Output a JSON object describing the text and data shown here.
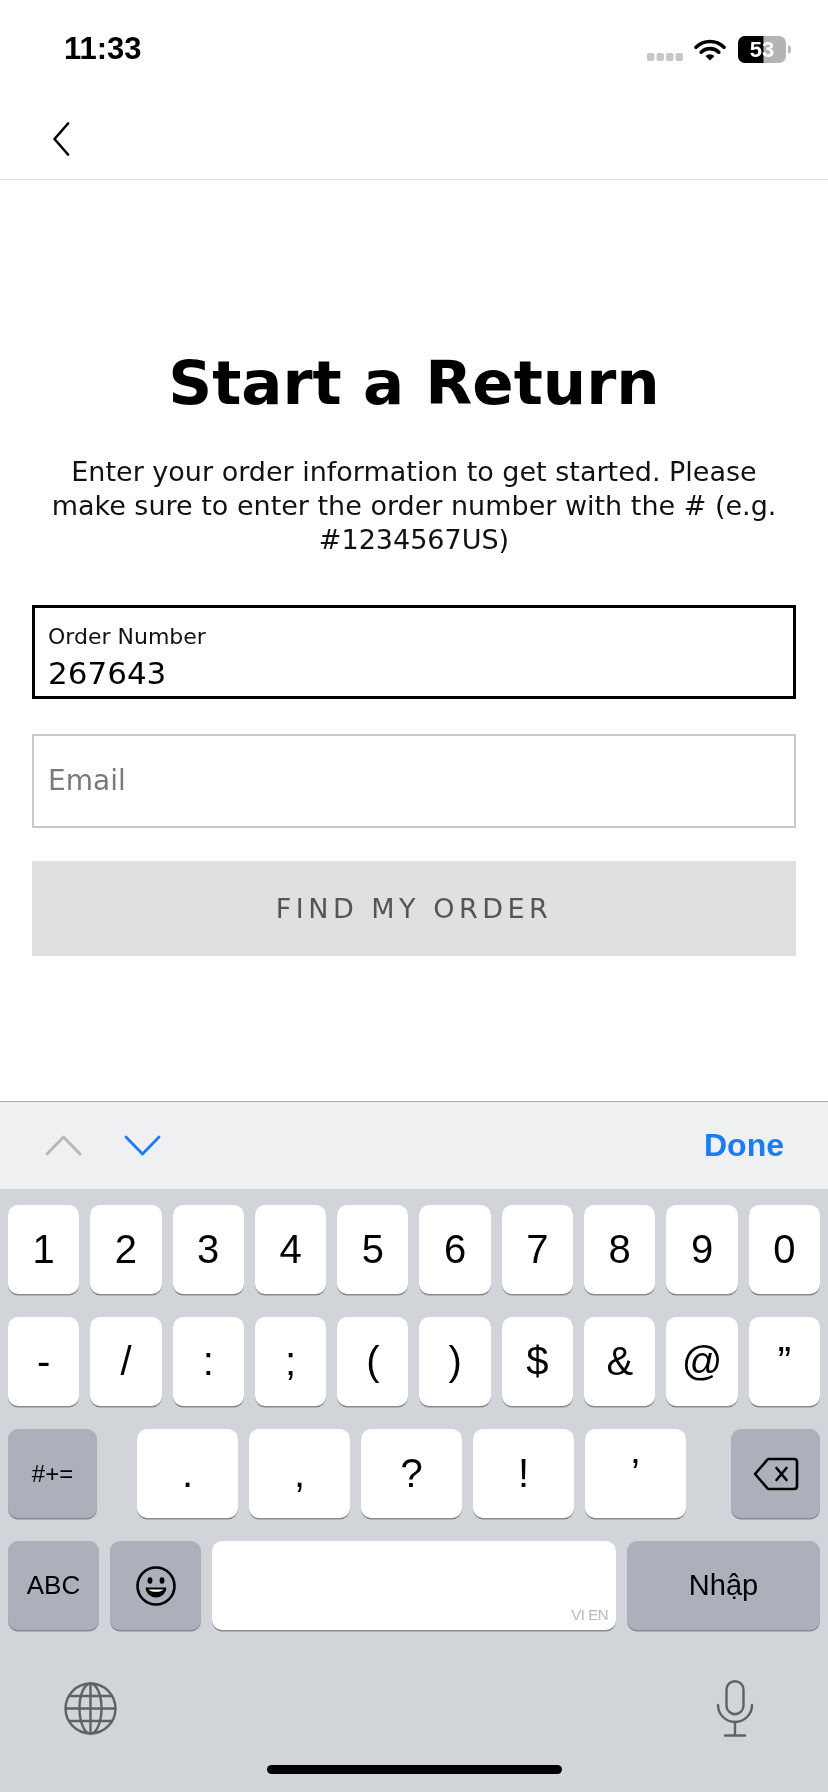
{
  "status_bar": {
    "time": "11:33",
    "battery": "53"
  },
  "page": {
    "title": "Start a Return",
    "description": "Enter your order information to get started. Please make sure to enter the order number with the # (e.g. #1234567US)"
  },
  "form": {
    "fields": [
      {
        "label": "Order Number",
        "value": "267643",
        "focused": true
      },
      {
        "placeholder": "Email",
        "focused": false
      }
    ],
    "submit": {
      "label": "FIND MY ORDER",
      "disabled": true
    }
  },
  "input_accessory": {
    "previous": {
      "disabled": true
    },
    "next": {
      "disabled": false
    },
    "done": "Done"
  },
  "keyboard": {
    "rows": [
      {
        "keys": [
          {
            "kind": "char",
            "label": "1"
          },
          {
            "kind": "char",
            "label": "2"
          },
          {
            "kind": "char",
            "label": "3"
          },
          {
            "kind": "char",
            "label": "4"
          },
          {
            "kind": "char",
            "label": "5"
          },
          {
            "kind": "char",
            "label": "6"
          },
          {
            "kind": "char",
            "label": "7"
          },
          {
            "kind": "char",
            "label": "8"
          },
          {
            "kind": "char",
            "label": "9"
          },
          {
            "kind": "char",
            "label": "0"
          }
        ]
      },
      {
        "keys": [
          {
            "kind": "char",
            "label": "-"
          },
          {
            "kind": "char",
            "label": "/"
          },
          {
            "kind": "char",
            "label": ":"
          },
          {
            "kind": "char",
            "label": ";"
          },
          {
            "kind": "char",
            "label": "("
          },
          {
            "kind": "char",
            "label": ")"
          },
          {
            "kind": "char",
            "label": "$"
          },
          {
            "kind": "char",
            "label": "&"
          },
          {
            "kind": "char",
            "label": "@"
          },
          {
            "kind": "char",
            "label": "”"
          }
        ]
      },
      {
        "keys": [
          {
            "kind": "symbols",
            "label": "#+="
          },
          {
            "kind": "char",
            "label": "."
          },
          {
            "kind": "char",
            "label": ","
          },
          {
            "kind": "char",
            "label": "?"
          },
          {
            "kind": "char",
            "label": "!"
          },
          {
            "kind": "char",
            "label": "’"
          },
          {
            "kind": "delete"
          }
        ]
      },
      {
        "keys": [
          {
            "kind": "letters",
            "label": "ABC"
          },
          {
            "kind": "emoji"
          },
          {
            "kind": "space",
            "hint": "VI EN"
          },
          {
            "kind": "return",
            "label": "Nhập"
          }
        ]
      }
    ]
  }
}
